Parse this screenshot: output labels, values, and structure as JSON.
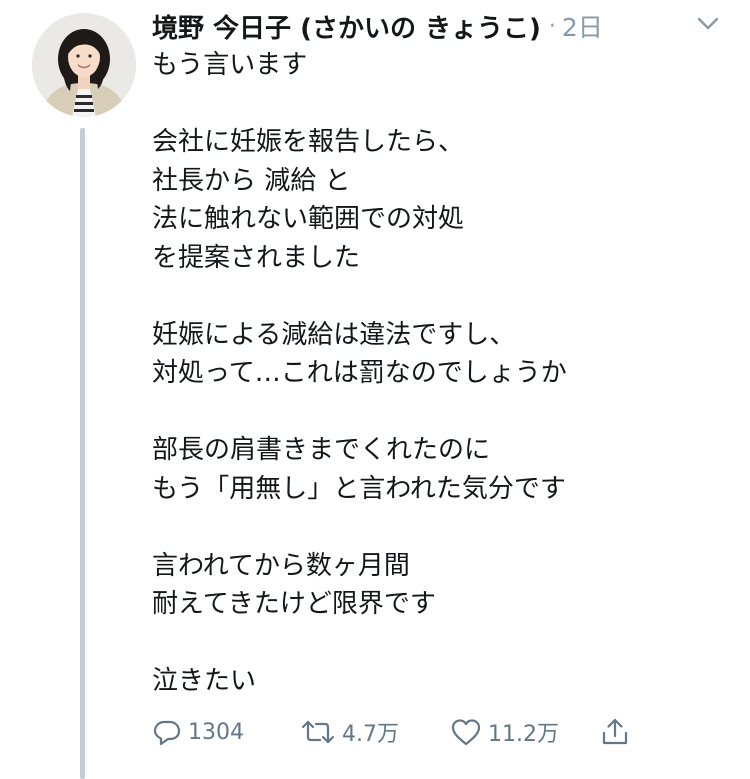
{
  "tweet": {
    "display_name": "境野 今日子 (さかいの きょうこ)",
    "separator": "·",
    "timestamp": "2日",
    "avatar_icon": "user-avatar-photo",
    "menu_icon": "chevron-down-icon",
    "text_lines": [
      "もう言います",
      "",
      "会社に妊娠を報告したら、",
      "社長から 減給 と",
      "法に触れない範囲での対処",
      "を提案されました",
      "",
      "妊娠による減給は違法ですし、",
      "対処って…これは罰なのでしょうか",
      "",
      "部長の肩書きまでくれたのに",
      "もう「用無し」と言われた気分です",
      "",
      "言われてから数ヶ月間",
      "耐えてきたけど限界です",
      "",
      "泣きたい"
    ]
  },
  "actions": {
    "reply": {
      "icon": "reply-icon",
      "count": "1304"
    },
    "retweet": {
      "icon": "retweet-icon",
      "count": "4.7万"
    },
    "like": {
      "icon": "heart-icon",
      "count": "11.2万"
    },
    "share": {
      "icon": "share-icon",
      "count": ""
    }
  },
  "colors": {
    "text": "#14171a",
    "secondary": "#8899a6",
    "action": "#657786",
    "thread_line": "#c4cdd4"
  }
}
